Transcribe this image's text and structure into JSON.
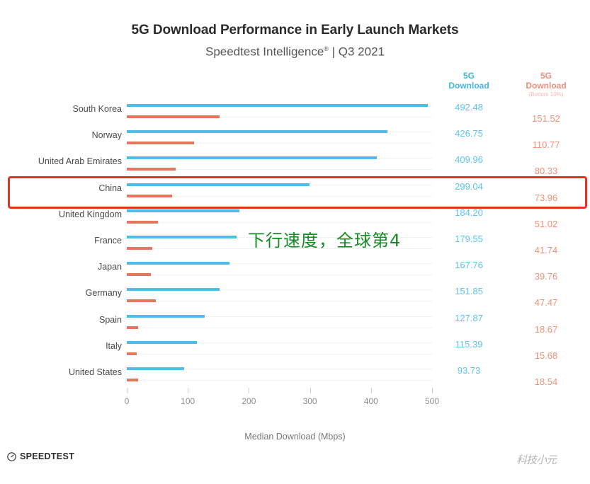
{
  "header": {
    "title": "5G Download Performance in Early Launch Markets",
    "subtitle_main": "Speedtest Intelligence",
    "subtitle_sup": "®",
    "subtitle_tail": " | Q3 2021"
  },
  "columns": {
    "blue_header_line1": "5G",
    "blue_header_line2": "Download",
    "red_header_line1": "5G",
    "red_header_line2": "Download",
    "red_header_sub": "(Bottom 10%)"
  },
  "annotation": {
    "text": "下行速度，全球第4",
    "color": "#138c23"
  },
  "highlight": {
    "country": "China",
    "color": "#e03322"
  },
  "axis": {
    "label": "Median Download (Mbps)",
    "ticks": [
      "0",
      "100",
      "200",
      "300",
      "400",
      "500"
    ]
  },
  "footer": {
    "brand": "SPEEDTEST",
    "watermark": "科技小元"
  },
  "colors": {
    "blue": "#4fbdea",
    "red": "#e8765e",
    "blue_text": "#5cc4ec",
    "red_text": "#ef9179"
  },
  "chart_data": {
    "type": "bar",
    "title": "5G Download Performance in Early Launch Markets",
    "subtitle": "Speedtest Intelligence® | Q3 2021",
    "xlabel": "Median Download (Mbps)",
    "ylabel": "",
    "xlim": [
      0,
      500
    ],
    "xticks": [
      0,
      100,
      200,
      300,
      400,
      500
    ],
    "grid": false,
    "orientation": "horizontal",
    "legend_position": "right-columns",
    "categories": [
      "South Korea",
      "Norway",
      "United Arab Emirates",
      "China",
      "United Kingdom",
      "France",
      "Japan",
      "Germany",
      "Spain",
      "Italy",
      "United States"
    ],
    "series": [
      {
        "name": "5G Download",
        "color": "#4fbdea",
        "values": [
          492.48,
          426.75,
          409.96,
          299.04,
          184.2,
          179.55,
          167.76,
          151.85,
          127.87,
          115.39,
          93.73
        ]
      },
      {
        "name": "5G Download (Bottom 10%)",
        "color": "#e8765e",
        "values": [
          151.52,
          110.77,
          80.33,
          73.96,
          51.02,
          41.74,
          39.76,
          47.47,
          18.67,
          15.68,
          18.54
        ]
      }
    ],
    "annotations": [
      {
        "text": "下行速度，全球第4",
        "color": "#138c23"
      },
      {
        "text": "China row highlighted",
        "color": "#e03322"
      }
    ]
  },
  "rows": [
    {
      "country": "South Korea",
      "blue": "492.48",
      "red": "151.52",
      "blue_v": 492.48,
      "red_v": 151.52
    },
    {
      "country": "Norway",
      "blue": "426.75",
      "red": "110.77",
      "blue_v": 426.75,
      "red_v": 110.77
    },
    {
      "country": "United Arab Emirates",
      "blue": "409.96",
      "red": "80.33",
      "blue_v": 409.96,
      "red_v": 80.33
    },
    {
      "country": "China",
      "blue": "299.04",
      "red": "73.96",
      "blue_v": 299.04,
      "red_v": 73.96
    },
    {
      "country": "United Kingdom",
      "blue": "184.20",
      "red": "51.02",
      "blue_v": 184.2,
      "red_v": 51.02
    },
    {
      "country": "France",
      "blue": "179.55",
      "red": "41.74",
      "blue_v": 179.55,
      "red_v": 41.74
    },
    {
      "country": "Japan",
      "blue": "167.76",
      "red": "39.76",
      "blue_v": 167.76,
      "red_v": 39.76
    },
    {
      "country": "Germany",
      "blue": "151.85",
      "red": "47.47",
      "blue_v": 151.85,
      "red_v": 47.47
    },
    {
      "country": "Spain",
      "blue": "127.87",
      "red": "18.67",
      "blue_v": 127.87,
      "red_v": 18.67
    },
    {
      "country": "Italy",
      "blue": "115.39",
      "red": "15.68",
      "blue_v": 115.39,
      "red_v": 15.68
    },
    {
      "country": "United States",
      "blue": "93.73",
      "red": "18.54",
      "blue_v": 93.73,
      "red_v": 18.54
    }
  ]
}
